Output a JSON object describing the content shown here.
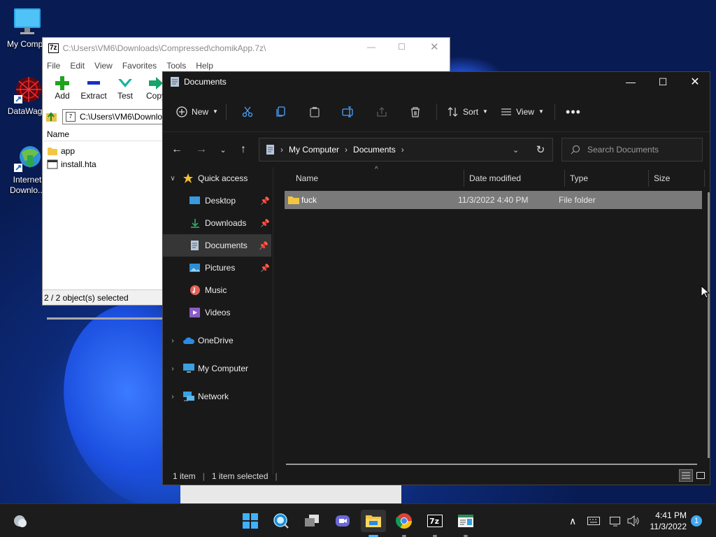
{
  "desktop": {
    "icons": [
      {
        "label": "My Compu",
        "icon": "computer-icon"
      },
      {
        "label": "DataWago",
        "icon": "datawagon-icon"
      },
      {
        "label": "Internet Downlo...",
        "icon": "internet-download-manager-icon"
      }
    ]
  },
  "sevenzip": {
    "title": "C:\\Users\\VM6\\Downloads\\Compressed\\chomikApp.7z\\",
    "title_icon": "7z",
    "menu": [
      "File",
      "Edit",
      "View",
      "Favorites",
      "Tools",
      "Help"
    ],
    "tools": [
      {
        "label": "Add",
        "icon": "plus-icon",
        "color": "#1fa31f"
      },
      {
        "label": "Extract",
        "icon": "minus-icon",
        "color": "#1a2fc8"
      },
      {
        "label": "Test",
        "icon": "check-icon",
        "color": "#17b3a3"
      },
      {
        "label": "Copy",
        "icon": "arrow-right-icon",
        "color": "#17a36a"
      }
    ],
    "address": "C:\\Users\\VM6\\Downlo",
    "column_name": "Name",
    "files": [
      {
        "name": "app",
        "icon": "folder-icon"
      },
      {
        "name": "install.hta",
        "icon": "hta-file-icon"
      }
    ],
    "status": "2 / 2 object(s) selected"
  },
  "explorer": {
    "title": "Documents",
    "commands": {
      "new": "New",
      "sort": "Sort",
      "view": "View"
    },
    "breadcrumb": [
      "My Computer",
      "Documents"
    ],
    "search_placeholder": "Search Documents",
    "sidebar": [
      {
        "label": "Quick access",
        "icon": "star-icon",
        "expand": "v",
        "pinned": false,
        "indent": 0
      },
      {
        "label": "Desktop",
        "icon": "desktop-icon",
        "pinned": true,
        "indent": 1
      },
      {
        "label": "Downloads",
        "icon": "download-icon",
        "pinned": true,
        "indent": 1
      },
      {
        "label": "Documents",
        "icon": "documents-icon",
        "pinned": true,
        "indent": 1,
        "selected": true
      },
      {
        "label": "Pictures",
        "icon": "pictures-icon",
        "pinned": true,
        "indent": 1
      },
      {
        "label": "Music",
        "icon": "music-icon",
        "pinned": false,
        "indent": 1
      },
      {
        "label": "Videos",
        "icon": "videos-icon",
        "pinned": false,
        "indent": 1
      },
      {
        "label": "OneDrive",
        "icon": "onedrive-icon",
        "expand": ">",
        "pinned": false,
        "indent": 0
      },
      {
        "label": "My Computer",
        "icon": "computer-icon",
        "expand": ">",
        "pinned": false,
        "indent": 0
      },
      {
        "label": "Network",
        "icon": "network-icon",
        "expand": ">",
        "pinned": false,
        "indent": 0
      }
    ],
    "columns": [
      "Name",
      "Date modified",
      "Type",
      "Size"
    ],
    "files": [
      {
        "name": "fuck",
        "date": "11/3/2022 4:40 PM",
        "type": "File folder",
        "size": ""
      }
    ],
    "status_items": "1 item",
    "status_selected": "1 item selected"
  },
  "taskbar": {
    "apps": [
      "windows-start-icon",
      "search-icon",
      "task-view-icon",
      "chat-icon",
      "file-explorer-icon",
      "chrome-icon",
      "7zip-icon",
      "notepad-icon"
    ],
    "time": "4:41 PM",
    "date": "11/3/2022",
    "notification_count": "1"
  },
  "colors": {
    "explorer_bg": "#191919",
    "selected_row": "#7a7a7a",
    "accent": "#1e6fd9"
  }
}
